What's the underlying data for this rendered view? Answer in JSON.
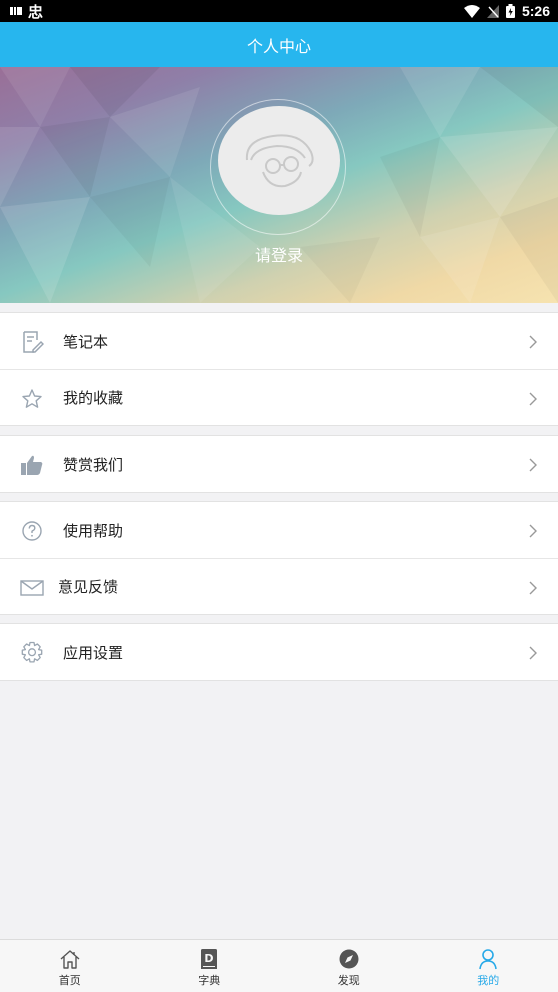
{
  "status_bar": {
    "time": "5:26",
    "app_glyph": "忠"
  },
  "header": {
    "title": "个人中心"
  },
  "profile": {
    "login_prompt": "请登录"
  },
  "menu": {
    "notebook": "笔记本",
    "favorites": "我的收藏",
    "appreciate": "赞赏我们",
    "help": "使用帮助",
    "feedback": "意见反馈",
    "settings": "应用设置"
  },
  "tabs": [
    {
      "label": "首页",
      "icon": "home-icon"
    },
    {
      "label": "字典",
      "icon": "dictionary-icon"
    },
    {
      "label": "发现",
      "icon": "compass-icon"
    },
    {
      "label": "我的",
      "icon": "user-icon",
      "active": true
    }
  ],
  "colors": {
    "accent": "#27b6ee",
    "active_tab": "#27a9e8",
    "icon_gray": "#9aa5b1"
  }
}
